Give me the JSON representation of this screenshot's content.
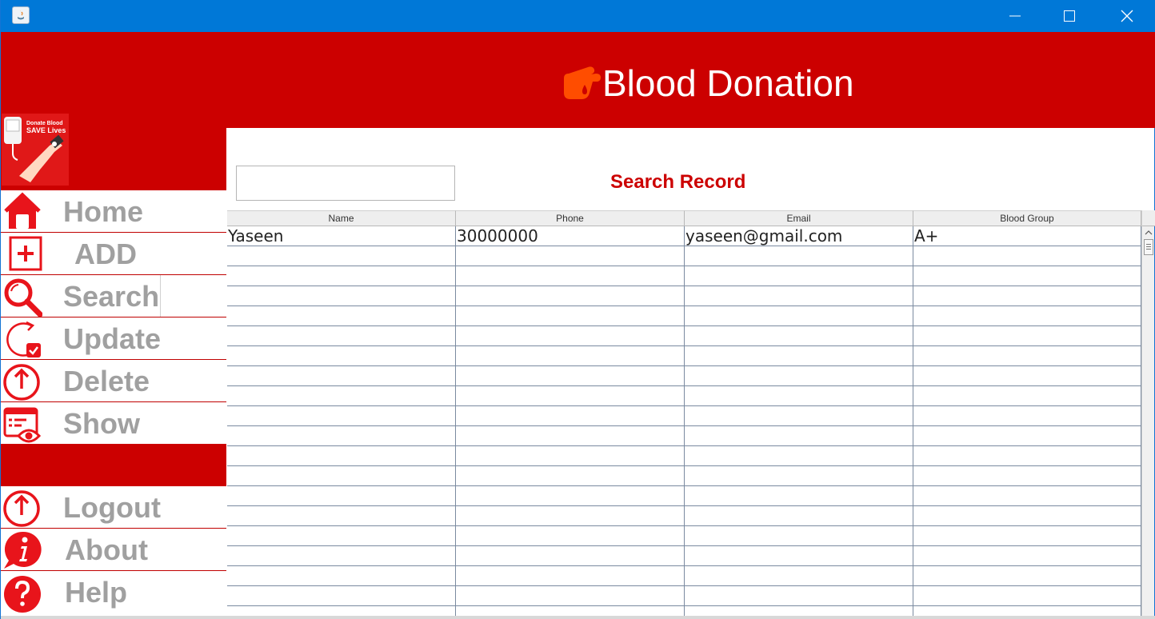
{
  "window": {
    "title": "",
    "controls": [
      "minimize-icon",
      "maximize-icon",
      "close-icon"
    ]
  },
  "header": {
    "title": "Blood Donation",
    "icon": "blood-drop-hand-icon"
  },
  "logo": {
    "line1": "Donate Blood",
    "line2": "SAVE Lives"
  },
  "sidebar": {
    "items": [
      {
        "label": "Home",
        "icon": "home-icon"
      },
      {
        "label": "ADD",
        "icon": "add-icon"
      },
      {
        "label": "Search",
        "icon": "search-icon"
      },
      {
        "label": "Update",
        "icon": "update-icon"
      },
      {
        "label": "Delete",
        "icon": "delete-icon"
      },
      {
        "label": "Show",
        "icon": "show-icon"
      }
    ],
    "bottom_items": [
      {
        "label": "Logout",
        "icon": "logout-icon"
      },
      {
        "label": "About",
        "icon": "about-icon"
      },
      {
        "label": "Help",
        "icon": "help-icon"
      }
    ]
  },
  "search": {
    "value": "",
    "heading": "Search Record"
  },
  "table": {
    "columns": [
      "Name",
      "Phone",
      "Email",
      "Blood Group"
    ],
    "rows": [
      [
        "Yaseen",
        "30000000",
        "yaseen@gmail.com",
        "A+"
      ]
    ],
    "empty_rows": 19
  },
  "colors": {
    "accent": "#cc0000",
    "titlebar": "#0078d7",
    "nav_label": "#a0a0a0"
  }
}
